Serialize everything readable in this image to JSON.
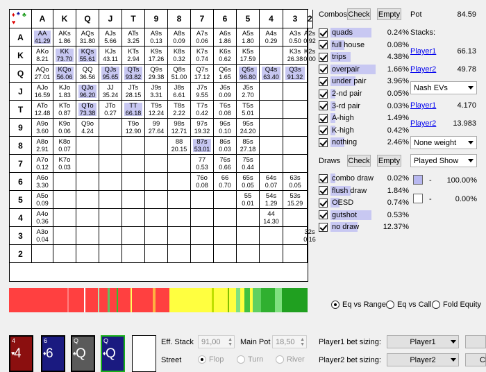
{
  "grid": {
    "ranks": [
      "A",
      "K",
      "Q",
      "J",
      "T",
      "9",
      "8",
      "7",
      "6",
      "5",
      "4",
      "3",
      "2"
    ],
    "cells": [
      [
        [
          "AA",
          "41.29",
          1
        ],
        [
          "AKs",
          "1.86",
          0
        ],
        [
          "AQs",
          "31.80",
          0
        ],
        [
          "AJs",
          "5.66",
          0
        ],
        [
          "ATs",
          "3.25",
          0
        ],
        [
          "A9s",
          "0.13",
          0
        ],
        [
          "A8s",
          "0.09",
          0
        ],
        [
          "A7s",
          "0.06",
          0
        ],
        [
          "A6s",
          "1.86",
          0
        ],
        [
          "A5s",
          "1.80",
          0
        ],
        [
          "A4s",
          "0.29",
          0
        ],
        [
          "A3s",
          "0.50",
          0
        ],
        [
          "A2s",
          "0.92",
          0
        ]
      ],
      [
        [
          "AKo",
          "8.21",
          0
        ],
        [
          "KK",
          "73.70",
          1
        ],
        [
          "KQs",
          "55.61",
          1
        ],
        [
          "KJs",
          "43.11",
          0
        ],
        [
          "KTs",
          "2.94",
          0
        ],
        [
          "K9s",
          "17.26",
          0
        ],
        [
          "K8s",
          "0.32",
          0
        ],
        [
          "K7s",
          "0.74",
          0
        ],
        [
          "K6s",
          "0.62",
          0
        ],
        [
          "K5s",
          "17.59",
          0
        ],
        [
          "",
          ""
        ],
        [
          "K3s",
          "26.38",
          0
        ],
        [
          "K2s",
          "0.00",
          0
        ]
      ],
      [
        [
          "AQo",
          "27.01",
          0
        ],
        [
          "KQo",
          "56.06",
          1
        ],
        [
          "QQ",
          "36.56",
          0
        ],
        [
          "QJs",
          "95.65",
          1
        ],
        [
          "QTs",
          "93.82",
          1
        ],
        [
          "Q9s",
          "29.38",
          0
        ],
        [
          "Q8s",
          "51.00",
          0
        ],
        [
          "Q7s",
          "17.12",
          0
        ],
        [
          "Q6s",
          "1.65",
          0
        ],
        [
          "Q5s",
          "96.80",
          1
        ],
        [
          "Q4s",
          "63.40",
          1
        ],
        [
          "Q3s",
          "91.32",
          1
        ],
        [
          "",
          ""
        ]
      ],
      [
        [
          "AJo",
          "16.59",
          0
        ],
        [
          "KJo",
          "1.83",
          0
        ],
        [
          "QJo",
          "96.20",
          1
        ],
        [
          "JJ",
          "35.24",
          0
        ],
        [
          "JTs",
          "28.15",
          0
        ],
        [
          "J9s",
          "3.31",
          0
        ],
        [
          "J8s",
          "6.61",
          0
        ],
        [
          "J7s",
          "9.55",
          0
        ],
        [
          "J6s",
          "0.09",
          0
        ],
        [
          "J5s",
          "2.70",
          0
        ],
        [
          "",
          ""
        ],
        [
          "",
          ""
        ],
        [
          "",
          ""
        ]
      ],
      [
        [
          "ATo",
          "12.48",
          0
        ],
        [
          "KTo",
          "0.87",
          0
        ],
        [
          "QTo",
          "73.38",
          1
        ],
        [
          "JTo",
          "0.27",
          0
        ],
        [
          "TT",
          "66.18",
          1
        ],
        [
          "T9s",
          "12.24",
          0
        ],
        [
          "T8s",
          "2.22",
          0
        ],
        [
          "T7s",
          "0.42",
          0
        ],
        [
          "T6s",
          "0.08",
          0
        ],
        [
          "T5s",
          "5.01",
          0
        ],
        [
          "",
          ""
        ],
        [
          "",
          ""
        ],
        [
          "",
          ""
        ]
      ],
      [
        [
          "A9o",
          "3.60",
          0
        ],
        [
          "K9o",
          "0.06",
          0
        ],
        [
          "Q9o",
          "4.24",
          0
        ],
        [
          "",
          ""
        ],
        [
          "T9o",
          "12.90",
          0
        ],
        [
          "99",
          "27.64",
          0
        ],
        [
          "98s",
          "12.71",
          0
        ],
        [
          "97s",
          "19.32",
          0
        ],
        [
          "96s",
          "0.10",
          0
        ],
        [
          "95s",
          "24.20",
          0
        ],
        [
          "",
          ""
        ],
        [
          "",
          ""
        ],
        [
          "",
          ""
        ]
      ],
      [
        [
          "A8o",
          "2.91",
          0
        ],
        [
          "K8o",
          "0.07",
          0
        ],
        [
          "",
          ""
        ],
        [
          "",
          ""
        ],
        [
          "",
          ""
        ],
        [
          "",
          ""
        ],
        [
          "88",
          "20.15",
          0
        ],
        [
          "87s",
          "53.01",
          1
        ],
        [
          "86s",
          "0.03",
          0
        ],
        [
          "85s",
          "27.18",
          0
        ],
        [
          "",
          ""
        ],
        [
          "",
          ""
        ],
        [
          "",
          ""
        ]
      ],
      [
        [
          "A7o",
          "0.12",
          0
        ],
        [
          "K7o",
          "0.03",
          0
        ],
        [
          "",
          ""
        ],
        [
          "",
          ""
        ],
        [
          "",
          ""
        ],
        [
          "",
          ""
        ],
        [
          "",
          ""
        ],
        [
          "77",
          "0.53",
          0
        ],
        [
          "76s",
          "0.66",
          0
        ],
        [
          "75s",
          "0.44",
          0
        ],
        [
          "",
          ""
        ],
        [
          "",
          ""
        ],
        [
          "",
          ""
        ]
      ],
      [
        [
          "A6o",
          "3.30",
          0
        ],
        [
          "",
          ""
        ],
        [
          "",
          ""
        ],
        [
          "",
          ""
        ],
        [
          "",
          ""
        ],
        [
          "",
          ""
        ],
        [
          "",
          ""
        ],
        [
          "76o",
          "0.08",
          0
        ],
        [
          "66",
          "0.70",
          0
        ],
        [
          "65s",
          "0.05",
          0
        ],
        [
          "64s",
          "0.07",
          0
        ],
        [
          "63s",
          "0.05",
          0
        ],
        [
          "",
          ""
        ]
      ],
      [
        [
          "A5o",
          "0.09",
          0
        ],
        [
          "",
          ""
        ],
        [
          "",
          ""
        ],
        [
          "",
          ""
        ],
        [
          "",
          ""
        ],
        [
          "",
          ""
        ],
        [
          "",
          ""
        ],
        [
          "",
          ""
        ],
        [
          "",
          ""
        ],
        [
          "55",
          "0.01",
          0
        ],
        [
          "54s",
          "1.29",
          0
        ],
        [
          "53s",
          "15.29",
          0
        ],
        [
          "",
          ""
        ]
      ],
      [
        [
          "A4o",
          "0.36",
          0
        ],
        [
          "",
          ""
        ],
        [
          "",
          ""
        ],
        [
          "",
          ""
        ],
        [
          "",
          ""
        ],
        [
          "",
          ""
        ],
        [
          "",
          ""
        ],
        [
          "",
          ""
        ],
        [
          "",
          ""
        ],
        [
          "",
          ""
        ],
        [
          "44",
          "14.30",
          0
        ],
        [
          "",
          ""
        ],
        [
          "",
          ""
        ]
      ],
      [
        [
          "A3o",
          "0.04",
          0
        ],
        [
          "",
          ""
        ],
        [
          "",
          ""
        ],
        [
          "",
          ""
        ],
        [
          "",
          ""
        ],
        [
          "",
          ""
        ],
        [
          "",
          ""
        ],
        [
          "",
          ""
        ],
        [
          "",
          ""
        ],
        [
          "",
          ""
        ],
        [
          "",
          ""
        ],
        [
          "",
          ""
        ],
        [
          "32s",
          "0.16",
          0
        ]
      ],
      [
        [
          "",
          ""
        ],
        [
          "",
          ""
        ],
        [
          "",
          ""
        ],
        [
          "",
          ""
        ],
        [
          "",
          ""
        ],
        [
          "",
          ""
        ],
        [
          "",
          ""
        ],
        [
          "",
          ""
        ],
        [
          "",
          ""
        ],
        [
          "",
          ""
        ],
        [
          "",
          ""
        ],
        [
          "",
          ""
        ],
        [
          "",
          ""
        ]
      ]
    ]
  },
  "equity_bar": [
    {
      "c": "#ff4040",
      "w": 83
    },
    {
      "c": "#ff8080",
      "w": 2
    },
    {
      "c": "#ff4040",
      "w": 22
    },
    {
      "c": "#ffffff",
      "w": 2
    },
    {
      "c": "#ff4040",
      "w": 18
    },
    {
      "c": "#b0e0b0",
      "w": 2
    },
    {
      "c": "#ff4040",
      "w": 12
    },
    {
      "c": "#60c060",
      "w": 3
    },
    {
      "c": "#ff4040",
      "w": 10
    },
    {
      "c": "#30c030",
      "w": 2
    },
    {
      "c": "#ff4040",
      "w": 18
    },
    {
      "c": "#ffff60",
      "w": 2
    },
    {
      "c": "#ff4040",
      "w": 30
    },
    {
      "c": "#ffb040",
      "w": 4
    },
    {
      "c": "#ff4040",
      "w": 20
    },
    {
      "c": "#ffff40",
      "w": 60
    },
    {
      "c": "#c0e000",
      "w": 3
    },
    {
      "c": "#ffff40",
      "w": 20
    },
    {
      "c": "#80c000",
      "w": 2
    },
    {
      "c": "#ffff40",
      "w": 10
    },
    {
      "c": "#80e080",
      "w": 6
    },
    {
      "c": "#ffff40",
      "w": 6
    },
    {
      "c": "#40c040",
      "w": 8
    },
    {
      "c": "#ffff40",
      "w": 4
    },
    {
      "c": "#60d060",
      "w": 12
    },
    {
      "c": "#30b030",
      "w": 20
    },
    {
      "c": "#80e080",
      "w": 10
    },
    {
      "c": "#20a020",
      "w": 36
    }
  ],
  "combos": {
    "title": "Combos",
    "check": "Check",
    "empty": "Empty",
    "items": [
      {
        "label": "quads",
        "pct": "0.24%",
        "fill": 0.9
      },
      {
        "label": "full house",
        "pct": "0.08%",
        "fill": 0.3
      },
      {
        "label": "trips",
        "pct": "4.38%",
        "fill": 0.45
      },
      {
        "label": "overpair",
        "pct": "1.66%",
        "fill": 1.0
      },
      {
        "label": "under pair",
        "pct": "3.96%",
        "fill": 0.55
      },
      {
        "label": "2-nd pair",
        "pct": "0.05%",
        "fill": 0.1
      },
      {
        "label": "3-rd pair",
        "pct": "0.03%",
        "fill": 0.1
      },
      {
        "label": "A-high",
        "pct": "1.49%",
        "fill": 0.1
      },
      {
        "label": "K-high",
        "pct": "0.42%",
        "fill": 0.1
      },
      {
        "label": "nothing",
        "pct": "2.46%",
        "fill": 0.3
      }
    ]
  },
  "draws": {
    "title": "Draws",
    "check": "Check",
    "empty": "Empty",
    "items": [
      {
        "label": "combo draw",
        "pct": "0.02%",
        "fill": 0.1
      },
      {
        "label": "flush draw",
        "pct": "1.84%",
        "fill": 0.45
      },
      {
        "label": "OESD",
        "pct": "0.74%",
        "fill": 0.2
      },
      {
        "label": "gutshot",
        "pct": "0.53%",
        "fill": 0.9
      },
      {
        "label": "no draw",
        "pct": "12.37%",
        "fill": 0.6
      }
    ]
  },
  "info": {
    "pot_label": "Pot",
    "pot": "84.59",
    "stacks_label": "Stacks:",
    "p1": "Player1",
    "p1_stack": "66.13",
    "p2": "Player2",
    "p2_stack": "49.78",
    "ev_select": "Nash EVs",
    "p1_ev": "4.170",
    "p2_ev": "13.983",
    "weight_select": "None weight",
    "show_select": "Played Show",
    "legend1_pct": "100.00%",
    "legend2_pct": "0.00%",
    "dash": "-",
    "legend1_color": "#b8b8f0",
    "legend2_color": "#ffffff"
  },
  "radios": {
    "eq_range": "Eq vs Range",
    "eq_call": "Eq vs Call",
    "fold_eq": "Fold Equity"
  },
  "cards": [
    {
      "rank": "4",
      "suit": "♥",
      "big": "4",
      "color": "#8b0f0f"
    },
    {
      "rank": "6",
      "suit": "♦",
      "big": "6",
      "color": "#1a1a80"
    },
    {
      "rank": "Q",
      "suit": "♠",
      "big": "Q",
      "color": "#5a5a5a"
    },
    {
      "rank": "Q",
      "suit": "♦",
      "big": "Q",
      "color": "#1a1a80"
    }
  ],
  "bottom": {
    "eff_stack_label": "Eff. Stack",
    "eff_stack": "91,00",
    "main_pot_label": "Main Pot",
    "main_pot": "18,50",
    "street_label": "Street",
    "flop": "Flop",
    "turn": "Turn",
    "river": "River",
    "p1_sizing_label": "Player1 bet sizing:",
    "p1_sizing": "Player1",
    "p2_sizing_label": "Player2 bet sizing:",
    "p2_sizing": "Player2",
    "cl": "Cl"
  }
}
